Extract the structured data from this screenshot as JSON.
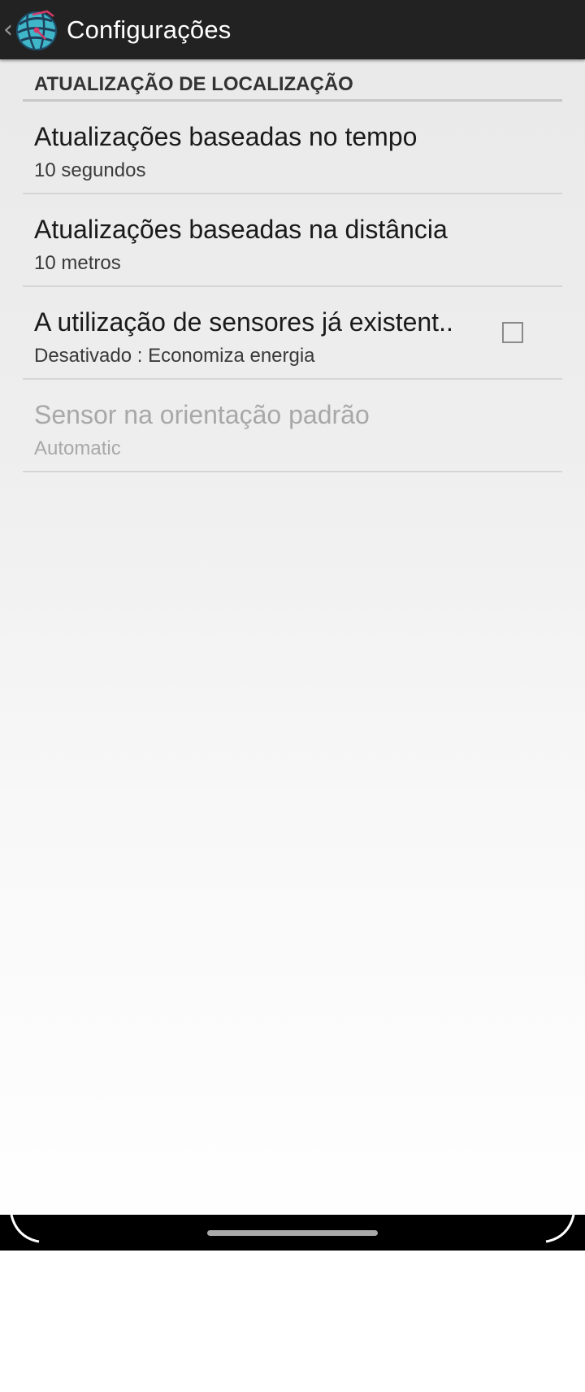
{
  "action_bar": {
    "title": "Configurações",
    "up_icon": "chevron-left-icon",
    "app_icon": "app-logo-icon"
  },
  "preferences": {
    "category_title": "ATUALIZAÇÃO DE LOCALIZAÇÃO",
    "items": [
      {
        "title": "Atualizações baseadas no tempo",
        "summary": "10 segundos",
        "enabled": true
      },
      {
        "title": "Atualizações baseadas na distância",
        "summary": "10 metros",
        "enabled": true
      },
      {
        "title": "A utilização de sensores já existent..",
        "summary": "Desativado : Economiza energia",
        "enabled": true,
        "checkbox_checked": false
      },
      {
        "title": "Sensor na orientação padrão",
        "summary": "Automatic",
        "enabled": false
      }
    ]
  },
  "colors": {
    "action_bar": "#222222",
    "app_icon_accent": "#3fb7c9",
    "disabled_text": "#a8a8a8"
  },
  "nav_bar": {
    "home_indicator": "home-indicator"
  }
}
